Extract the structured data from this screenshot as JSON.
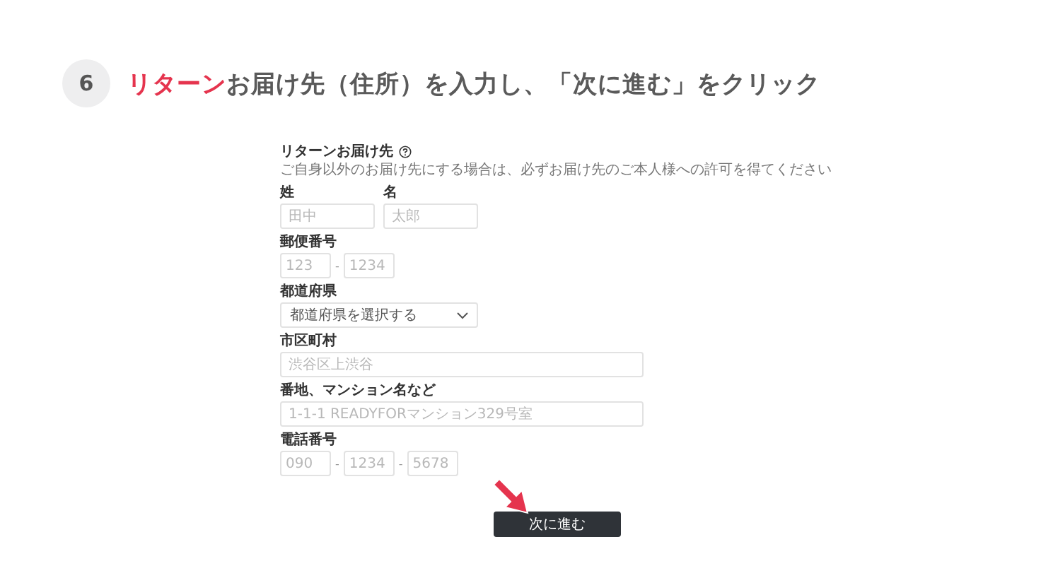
{
  "step": {
    "number": "6",
    "title_highlight": "リターン",
    "title_rest": "お届け先（住所）を入力し、「次に進む」をクリック"
  },
  "form": {
    "title": "リターンお届け先",
    "note": "ご自身以外のお届け先にする場合は、必ずお届け先のご本人様への許可を得てください",
    "rows": [
      {
        "fields": [
          {
            "label": "姓",
            "kind": "half",
            "placeholder": "田中"
          },
          {
            "label": "名",
            "kind": "half",
            "placeholder": "太郎"
          }
        ]
      },
      {
        "fields": [
          {
            "label": "郵便番号",
            "kind": "split",
            "separator": "-",
            "parts": [
              {
                "placeholder": "123"
              },
              {
                "placeholder": "1234"
              }
            ]
          }
        ]
      },
      {
        "fields": [
          {
            "label": "都道府県",
            "kind": "select",
            "value": "都道府県を選択する"
          }
        ]
      },
      {
        "fields": [
          {
            "label": "市区町村",
            "kind": "wide",
            "placeholder": "渋谷区上渋谷"
          }
        ]
      },
      {
        "fields": [
          {
            "label": "番地、マンション名など",
            "kind": "wide",
            "placeholder": "1-1-1 READYFORマンション329号室"
          }
        ]
      },
      {
        "fields": [
          {
            "label": "電話番号",
            "kind": "split",
            "separator": "-",
            "parts": [
              {
                "placeholder": "090"
              },
              {
                "placeholder": "1234"
              },
              {
                "placeholder": "5678"
              }
            ]
          }
        ]
      }
    ],
    "submit": "次に進む"
  }
}
